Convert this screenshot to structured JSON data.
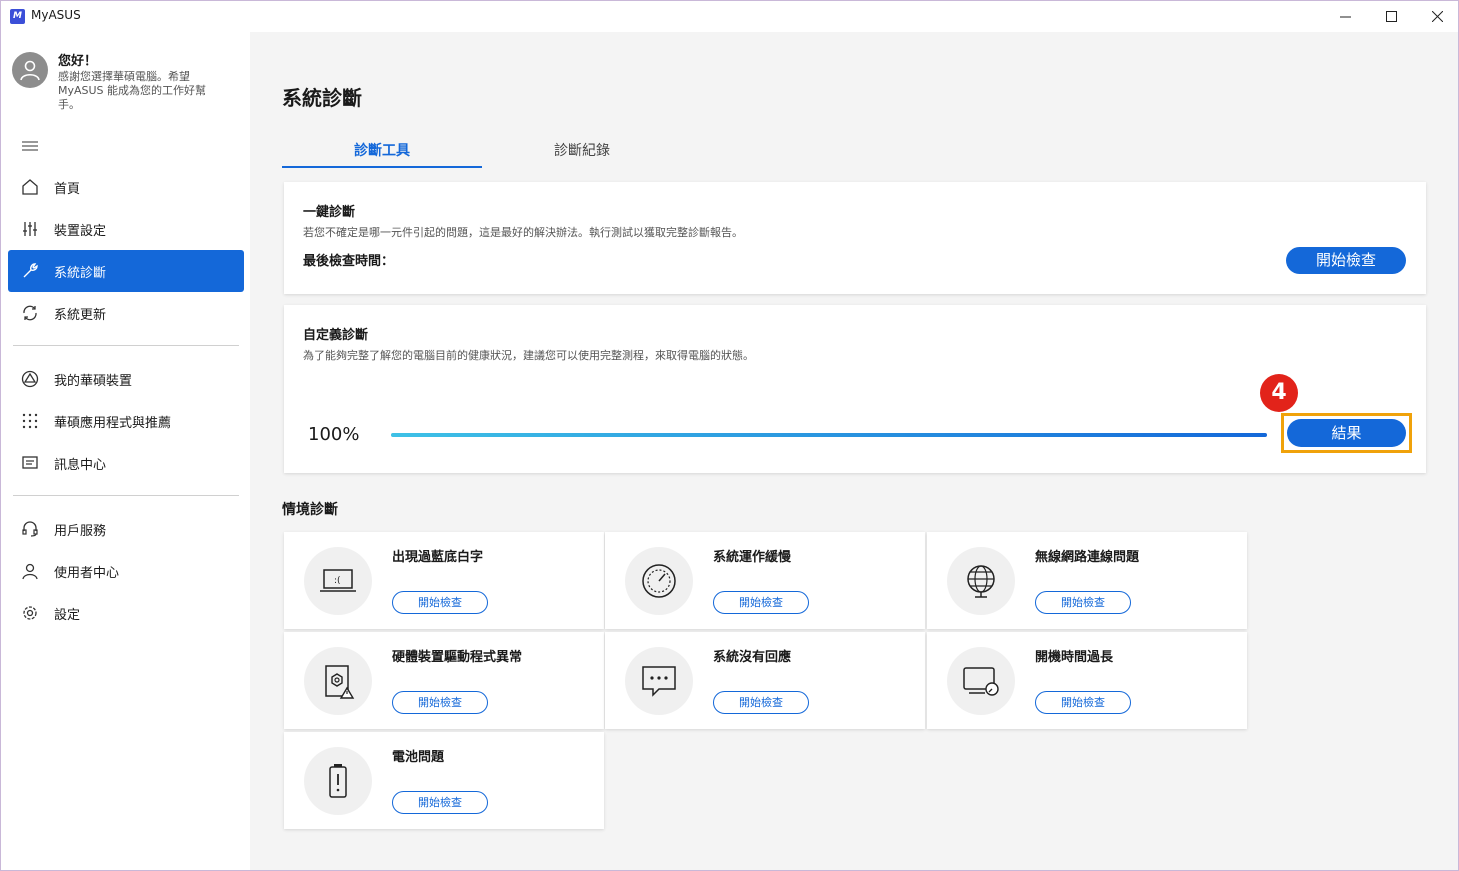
{
  "window": {
    "title": "MyASUS",
    "logo_text": "M"
  },
  "sidebar": {
    "greeting_title": "您好！",
    "greeting_text": "感謝您選擇華碩電腦。希望 MyASUS 能成為您的工作好幫手。",
    "items": [
      {
        "label": "首頁",
        "icon": "home-icon"
      },
      {
        "label": "裝置設定",
        "icon": "sliders-icon"
      },
      {
        "label": "系統診斷",
        "icon": "wrench-icon",
        "active": true
      },
      {
        "label": "系統更新",
        "icon": "update-icon"
      },
      {
        "label": "我的華碩裝置",
        "icon": "devices-icon"
      },
      {
        "label": "華碩應用程式與推薦",
        "icon": "apps-grid-icon"
      },
      {
        "label": "訊息中心",
        "icon": "message-icon"
      },
      {
        "label": "用戶服務",
        "icon": "headset-icon"
      },
      {
        "label": "使用者中心",
        "icon": "user-icon"
      },
      {
        "label": "設定",
        "icon": "gear-icon"
      }
    ]
  },
  "main": {
    "page_title": "系統診斷",
    "tabs": [
      {
        "label": "診斷工具",
        "active": true
      },
      {
        "label": "診斷紀錄",
        "active": false
      }
    ],
    "one_click": {
      "title": "一鍵診斷",
      "description": "若您不確定是哪一元件引起的問題，這是最好的解決辦法。執行測試以獲取完整診斷報告。",
      "last_check_label": "最後檢查時間：",
      "button": "開始檢查"
    },
    "custom": {
      "title": "自定義診斷",
      "description": "為了能夠完整了解您的電腦目前的健康狀況，建議您可以使用完整測程，來取得電腦的狀態。",
      "progress_text": "100%",
      "progress_value": 1.0,
      "button": "結果",
      "step_badge": "4"
    },
    "scenario_title": "情境診斷",
    "scenarios": [
      {
        "title": "出現過藍底白字",
        "button": "開始檢查",
        "icon": "blue-screen-laptop-icon"
      },
      {
        "title": "系統運作緩慢",
        "button": "開始檢查",
        "icon": "speedometer-icon"
      },
      {
        "title": "無線網路連線問題",
        "button": "開始檢查",
        "icon": "globe-icon"
      },
      {
        "title": "硬體裝置驅動程式異常",
        "button": "開始檢查",
        "icon": "driver-warning-icon"
      },
      {
        "title": "系統沒有回應",
        "button": "開始檢查",
        "icon": "chat-dots-icon"
      },
      {
        "title": "開機時間過長",
        "button": "開始檢查",
        "icon": "monitor-clock-icon"
      },
      {
        "title": "電池問題",
        "button": "開始檢查",
        "icon": "battery-alert-icon"
      }
    ]
  },
  "colors": {
    "accent": "#1468d9",
    "highlight": "#f0a20a",
    "badge": "#e2231a",
    "progress_start": "#3ec1e6"
  }
}
